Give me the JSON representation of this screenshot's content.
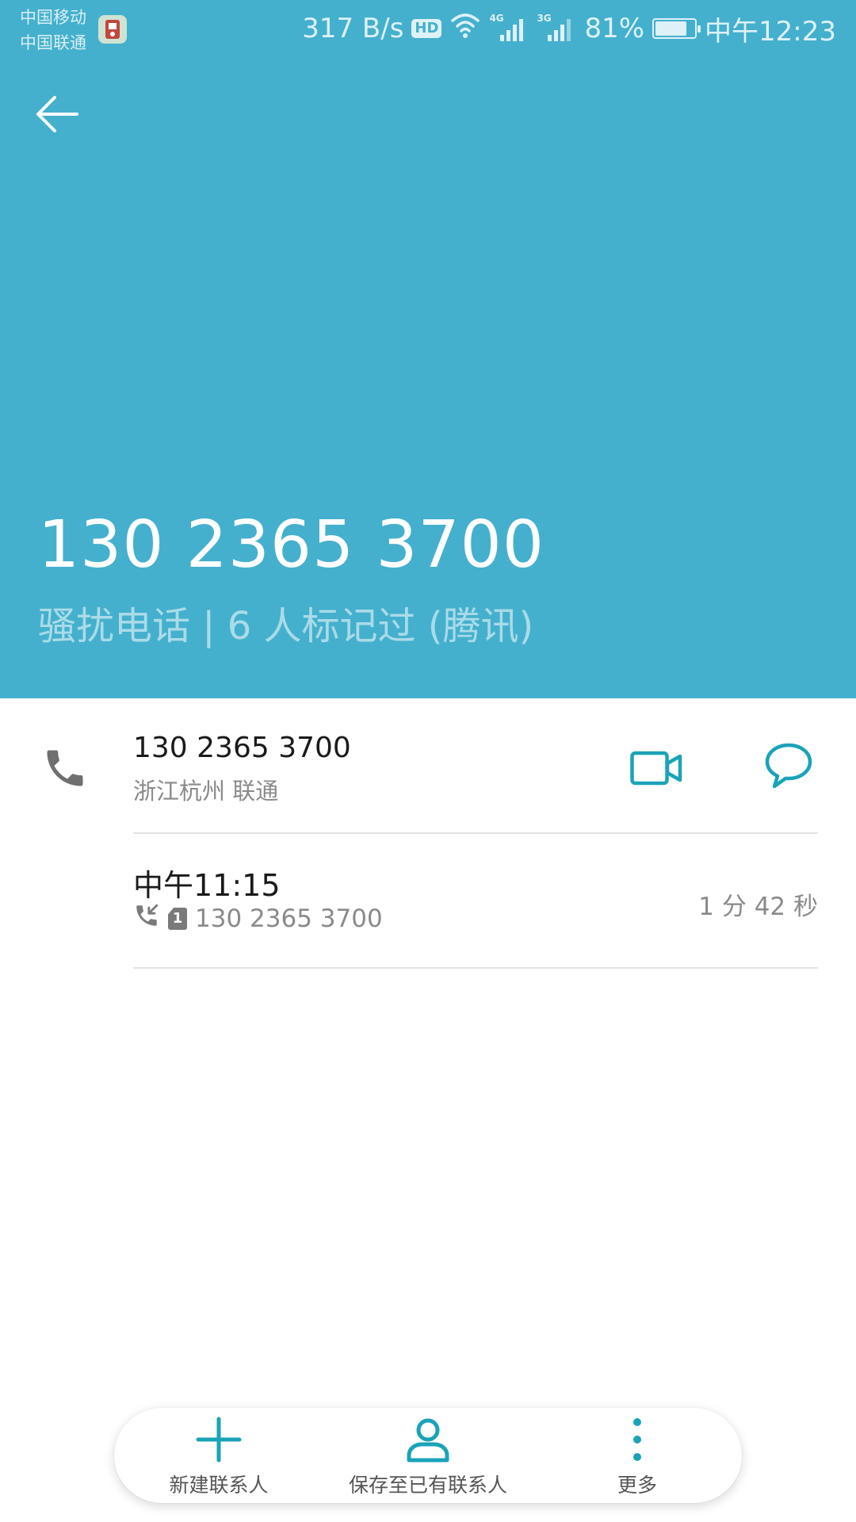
{
  "status_bar": {
    "carrier_1": "中国移动",
    "carrier_2": "中国联通",
    "speed": "317 B/s",
    "hd": "HD",
    "net_1": "4G",
    "net_2": "3G",
    "battery_percent": "81%",
    "battery_level": 0.81,
    "time": "中午12:23"
  },
  "header": {
    "number": "130 2365 3700",
    "tag": "骚扰电话 | 6 人标记过 (腾讯)"
  },
  "number_row": {
    "number": "130 2365 3700",
    "location": "浙江杭州 联通"
  },
  "call_log": {
    "time": "中午11:15",
    "sim": "1",
    "number": "130 2365 3700",
    "duration": "1 分 42 秒"
  },
  "actions": {
    "new_contact": "新建联系人",
    "save_existing": "保存至已有联系人",
    "more": "更多"
  },
  "colors": {
    "header_bg": "#44b0cd",
    "accent": "#1aa3b8"
  },
  "icons": {
    "back": "arrow-left-icon",
    "phone": "phone-icon",
    "video": "video-camera-icon",
    "message": "speech-bubble-icon",
    "incoming": "incoming-call-icon",
    "add": "plus-icon",
    "person": "person-icon",
    "more": "more-vertical-icon"
  }
}
